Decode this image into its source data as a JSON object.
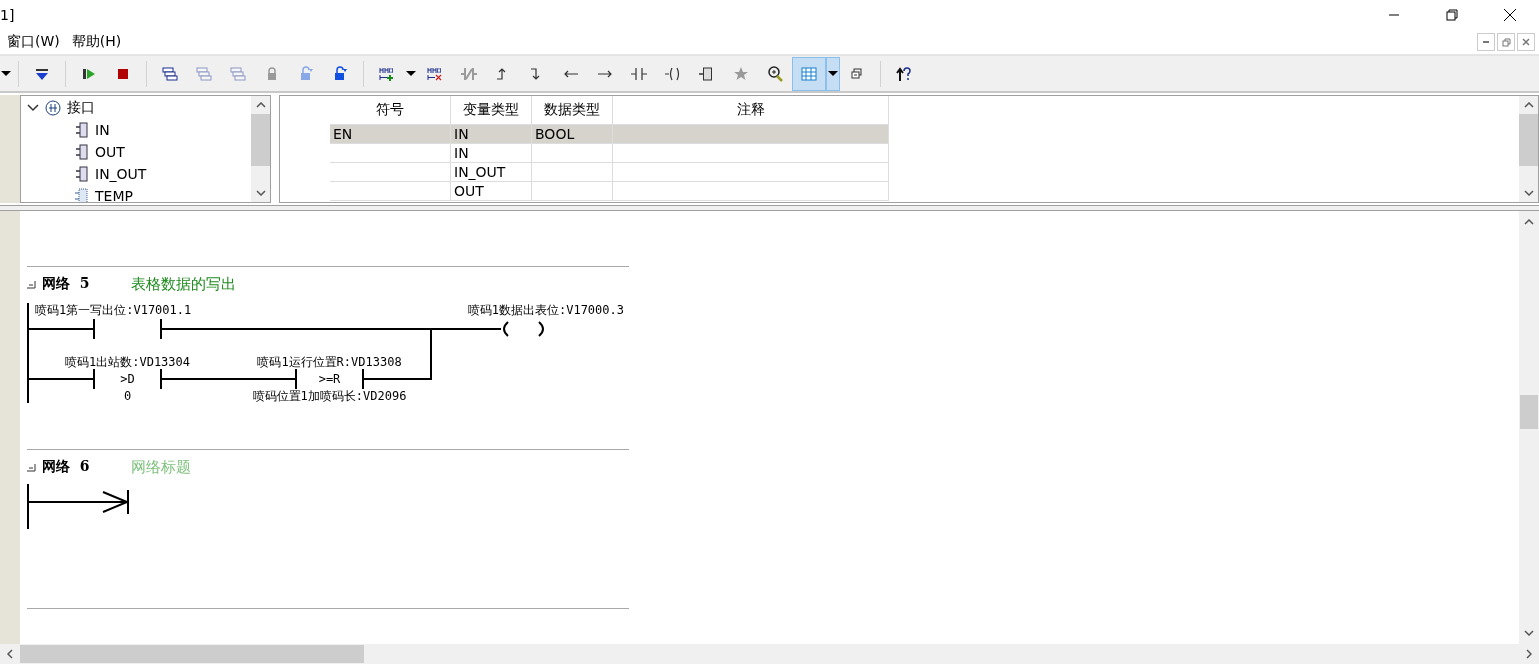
{
  "window": {
    "title": "1]"
  },
  "menu": [
    {
      "label": "窗口(W)"
    },
    {
      "label": "帮助(H)"
    }
  ],
  "toolbar": [
    [
      {
        "kind": "dropdown",
        "disabled": false,
        "selected": false
      }
    ],
    [
      {
        "kind": "download",
        "disabled": false,
        "selected": false
      }
    ],
    [
      {
        "kind": "run",
        "disabled": false,
        "selected": false
      },
      {
        "kind": "stop",
        "disabled": false,
        "selected": false
      }
    ],
    [
      {
        "kind": "windows",
        "disabled": false,
        "selected": false
      },
      {
        "kind": "windows",
        "disabled": true,
        "selected": false
      },
      {
        "kind": "windows",
        "disabled": true,
        "selected": false
      },
      {
        "kind": "lock",
        "disabled": true,
        "selected": false
      },
      {
        "kind": "unlock",
        "disabled": true,
        "selected": false
      },
      {
        "kind": "unlock",
        "disabled": false,
        "selected": false
      }
    ],
    [
      {
        "kind": "insert",
        "disabled": false,
        "selected": false
      },
      {
        "kind": "dropdown",
        "disabled": false,
        "selected": false
      },
      {
        "kind": "delete",
        "disabled": false,
        "selected": false
      },
      {
        "kind": "ncontact",
        "disabled": true,
        "selected": false
      },
      {
        "kind": "up",
        "disabled": false,
        "selected": false
      },
      {
        "kind": "down",
        "disabled": false,
        "selected": false
      },
      {
        "kind": "left",
        "disabled": false,
        "selected": false
      },
      {
        "kind": "right",
        "disabled": false,
        "selected": false
      },
      {
        "kind": "contact",
        "disabled": false,
        "selected": false
      },
      {
        "kind": "coil",
        "disabled": false,
        "selected": false
      },
      {
        "kind": "box",
        "disabled": false,
        "selected": false
      },
      {
        "kind": "star",
        "disabled": true,
        "selected": false
      },
      {
        "kind": "zoom",
        "disabled": false,
        "selected": false
      },
      {
        "kind": "table",
        "disabled": false,
        "selected": true
      },
      {
        "kind": "dropdown",
        "disabled": false,
        "selected": true
      },
      {
        "kind": "restore",
        "disabled": false,
        "selected": false
      }
    ],
    [
      {
        "kind": "help",
        "disabled": false,
        "selected": false
      }
    ]
  ],
  "tree": {
    "label": "接口",
    "expanded": true,
    "children": [
      {
        "label": "IN",
        "kind": "pin"
      },
      {
        "label": "OUT",
        "kind": "pin"
      },
      {
        "label": "IN_OUT",
        "kind": "pin"
      },
      {
        "label": "TEMP",
        "kind": "temp"
      }
    ]
  },
  "variable_table": {
    "columns": [
      "符号",
      "变量类型",
      "数据类型",
      "注释"
    ],
    "rows": [
      {
        "cells": [
          "EN",
          "IN",
          "BOOL",
          ""
        ],
        "selected": true
      },
      {
        "cells": [
          "",
          "IN",
          "",
          ""
        ],
        "selected": false
      },
      {
        "cells": [
          "",
          "IN_OUT",
          "",
          ""
        ],
        "selected": false
      },
      {
        "cells": [
          "",
          "OUT",
          "",
          ""
        ],
        "selected": false
      }
    ]
  },
  "networks": [
    {
      "label": "网络",
      "number": "5",
      "title": "表格数据的写出",
      "placeholder": false,
      "elements": [
        {
          "kind": "contact",
          "label": "喷码1第一写出位:V17001.1"
        },
        {
          "kind": "coil",
          "label": "喷码1数据出表位:V17000.3"
        },
        {
          "kind": "compare",
          "label": "喷码1出站数:VD13304",
          "operator": ">D",
          "operand": "0"
        },
        {
          "kind": "compare",
          "label": "喷码1运行位置R:VD13308",
          "operator": ">=R",
          "operand": "喷码位置1加喷码长:VD2096"
        }
      ]
    },
    {
      "label": "网络",
      "number": "6",
      "title": "网络标题",
      "placeholder": true
    }
  ]
}
